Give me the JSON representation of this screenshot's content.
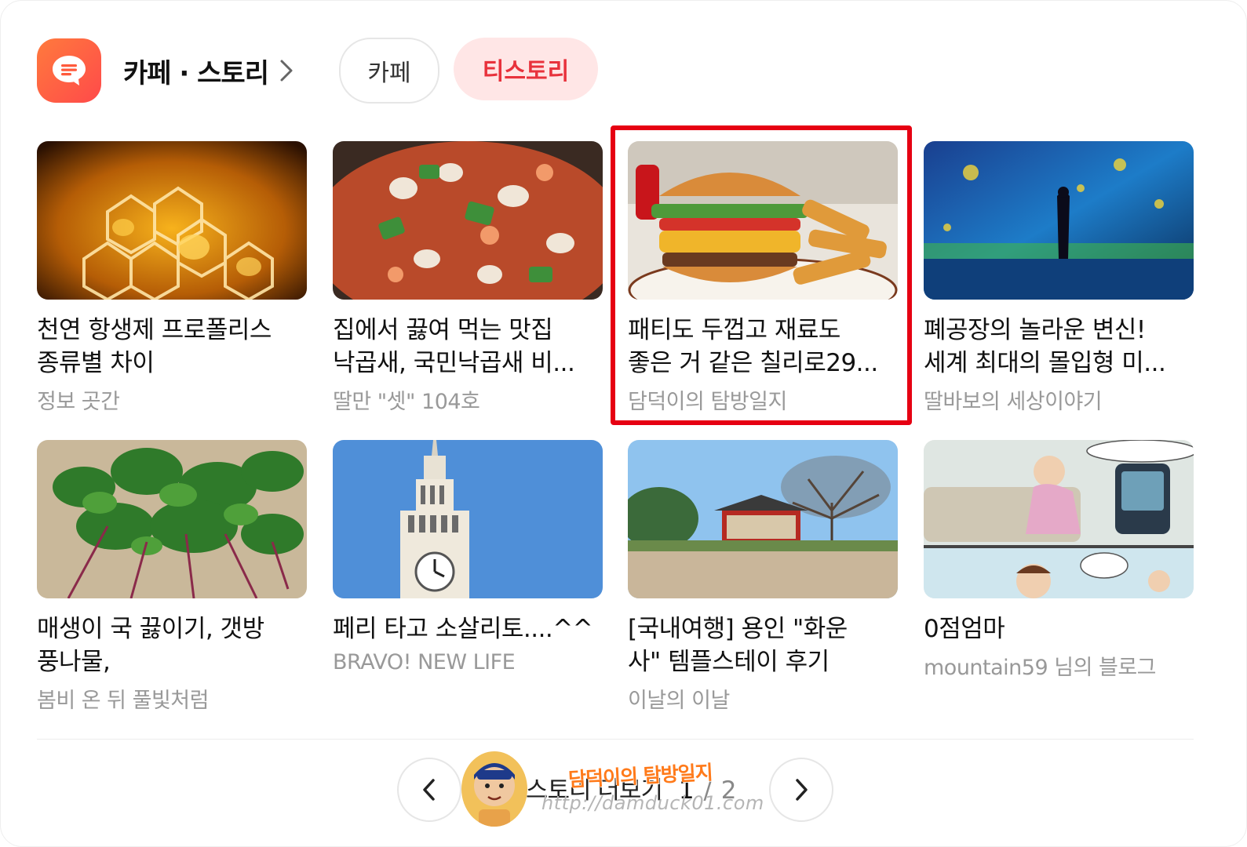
{
  "header": {
    "section_title": "카페 · 스토리",
    "tabs": [
      {
        "label": "카페",
        "active": false
      },
      {
        "label": "티스토리",
        "active": true
      }
    ]
  },
  "colors": {
    "accent": "#e8323c",
    "active_tab_bg": "#ffe6e6",
    "highlight": "#e60012",
    "logo": "#ff5a3c"
  },
  "cards": [
    {
      "title": "천연 항생제 프로폴리스\n종류별 차이",
      "source": "정보 곳간",
      "image": "propolis-honeycomb"
    },
    {
      "title": "집에서 끓여 먹는 맛집\n낙곱새, 국민낙곱새 비...",
      "source": "딸만 \"셋\" 104호",
      "image": "nakgopsae-dish"
    },
    {
      "title": "패티도 두껍고 재료도\n좋은 거 같은 칠리로29...",
      "source": "담덕이의 탐방일지",
      "image": "burger-and-fries",
      "highlighted": true
    },
    {
      "title": "폐공장의 놀라운 변신!\n세계 최대의 몰입형 미...",
      "source": "딸바보의 세상이야기",
      "image": "immersive-art-hall"
    },
    {
      "title": "매생이 국 끓이기, 갯방\n풍나물,",
      "source": "봄비 온 뒤 풀빛처럼",
      "image": "green-herbs"
    },
    {
      "title": "페리 타고 소살리토....^^",
      "source": "BRAVO! NEW LIFE",
      "image": "ferry-building-clock-tower"
    },
    {
      "title": "[국내여행] 용인 \"화운\n사\" 템플스테이 후기",
      "source": "이날의 이날",
      "image": "temple-yard"
    },
    {
      "title": "0점엄마",
      "source": "mountain59 님의 블로그",
      "image": "comic-strip"
    }
  ],
  "pager": {
    "label": "스토리 더보기",
    "current": "1",
    "separator": "/",
    "total": "2"
  },
  "watermark": {
    "title": "담덕이의 탐방일지",
    "url": "http://damduck01.com"
  }
}
